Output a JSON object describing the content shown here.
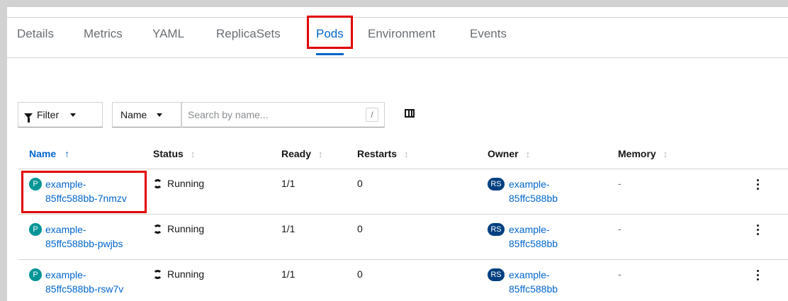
{
  "tabs": [
    {
      "label": "Details"
    },
    {
      "label": "Metrics"
    },
    {
      "label": "YAML"
    },
    {
      "label": "ReplicaSets"
    },
    {
      "label": "Pods"
    },
    {
      "label": "Environment"
    },
    {
      "label": "Events"
    }
  ],
  "active_tab": "Pods",
  "toolbar": {
    "filter_label": "Filter",
    "name_select": "Name",
    "search_placeholder": "Search by name...",
    "search_shortcut": "/"
  },
  "table": {
    "columns": [
      "Name",
      "Status",
      "Ready",
      "Restarts",
      "Owner",
      "Memory"
    ],
    "rows": [
      {
        "badge": "P",
        "name_line1": "example-",
        "name_line2": "85ffc588bb-7nmzv",
        "status": "Running",
        "ready": "1/1",
        "restarts": "0",
        "owner_badge": "RS",
        "owner_line1": "example-",
        "owner_line2": "85ffc588bb",
        "memory": "-"
      },
      {
        "badge": "P",
        "name_line1": "example-",
        "name_line2": "85ffc588bb-pwjbs",
        "status": "Running",
        "ready": "1/1",
        "restarts": "0",
        "owner_badge": "RS",
        "owner_line1": "example-",
        "owner_line2": "85ffc588bb",
        "memory": "-"
      },
      {
        "badge": "P",
        "name_line1": "example-",
        "name_line2": "85ffc588bb-rsw7v",
        "status": "Running",
        "ready": "1/1",
        "restarts": "0",
        "owner_badge": "RS",
        "owner_line1": "example-",
        "owner_line2": "85ffc588bb",
        "memory": "-"
      }
    ]
  },
  "colors": {
    "accent": "#0066cc",
    "highlight": "#e00000",
    "pod_badge": "#009596",
    "rs_badge": "#004080"
  }
}
